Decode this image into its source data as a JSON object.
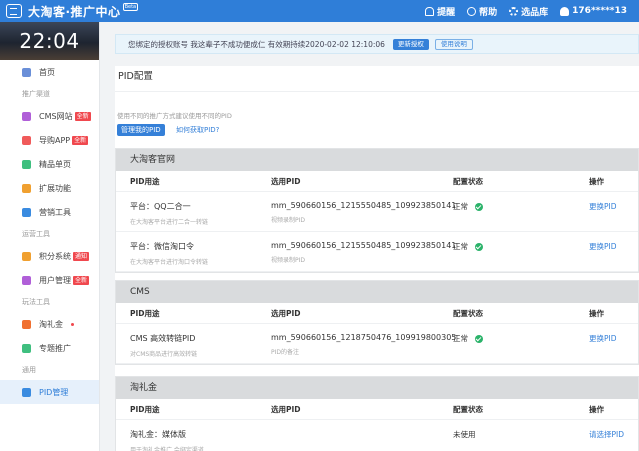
{
  "header": {
    "title": "大淘客·推广中心",
    "badge": "Beta",
    "actions": [
      {
        "label": "提醒",
        "icon": "bell-icon"
      },
      {
        "label": "帮助",
        "icon": "help-icon"
      },
      {
        "label": "选品库",
        "icon": "gear-icon"
      },
      {
        "label": "176*****13",
        "icon": "user-icon"
      }
    ]
  },
  "sidebar": {
    "clock": "22:04",
    "items": [
      {
        "type": "item",
        "label": "首页",
        "color": "#6a8fd8"
      },
      {
        "type": "group",
        "label": "推广渠道"
      },
      {
        "type": "item",
        "label": "CMS网站",
        "tag": "全新",
        "color": "#b05fd8"
      },
      {
        "type": "item",
        "label": "导购APP",
        "tag": "全新",
        "color": "#f05a5a"
      },
      {
        "type": "item",
        "label": "精品单页",
        "color": "#3fbf7f"
      },
      {
        "type": "item",
        "label": "扩展功能",
        "color": "#f0a030"
      },
      {
        "type": "item",
        "label": "营销工具",
        "color": "#3a8be0"
      },
      {
        "type": "group",
        "label": "运营工具"
      },
      {
        "type": "item",
        "label": "积分系统",
        "tag": "通知",
        "color": "#f0a030"
      },
      {
        "type": "item",
        "label": "用户管理",
        "tag": "全新",
        "color": "#b05fd8"
      },
      {
        "type": "group",
        "label": "玩法工具"
      },
      {
        "type": "item",
        "label": "淘礼金",
        "dot": true,
        "color": "#f07030"
      },
      {
        "type": "item",
        "label": "专题推广",
        "color": "#3fbf7f"
      },
      {
        "type": "group",
        "label": "通用"
      },
      {
        "type": "item",
        "label": "PID管理",
        "active": true,
        "color": "#3a8be0"
      }
    ]
  },
  "notice": {
    "text": "您绑定的授权账号 我这辈子不成功便成仁 有效期持续2020-02-02 12:10:06",
    "renew": "更新授权",
    "guide": "使用说明"
  },
  "page": {
    "title": "PID配置",
    "hint": "使用不同的推广方式建议使用不同的PID",
    "manage_btn": "管理我的PID",
    "how_link": "如何获取PID?"
  },
  "columns": {
    "purpose": "PID用途",
    "pid": "选用PID",
    "status": "配置状态",
    "op": "操作"
  },
  "sections": [
    {
      "title": "大淘客官网",
      "rows": [
        {
          "name": "平台：QQ二合一",
          "desc": "在大淘客平台进行二合一转链",
          "pid": "mm_590660156_1215550485_109923850141",
          "pid_note": "视频录制PID",
          "status": "正常",
          "op": "更换PID"
        },
        {
          "name": "平台：微信淘口令",
          "desc": "在大淘客平台进行淘口令转链",
          "pid": "mm_590660156_1215550485_109923850141",
          "pid_note": "视频录制PID",
          "status": "正常",
          "op": "更换PID"
        }
      ]
    },
    {
      "title": "CMS",
      "rows": [
        {
          "name": "CMS 高效转链PID",
          "desc": "对CMS商品进行高效转链",
          "pid": "mm_590660156_1218750476_109919800305",
          "pid_note": "PID的备注",
          "status": "正常",
          "op": "更换PID"
        }
      ]
    },
    {
      "title": "淘礼金",
      "rows": [
        {
          "name": "淘礼金：媒体版",
          "desc": "用于淘礼金推广 会绑定渠道",
          "pid": "",
          "pid_note": "",
          "status": "未使用",
          "op": "请选择PID"
        }
      ]
    }
  ]
}
